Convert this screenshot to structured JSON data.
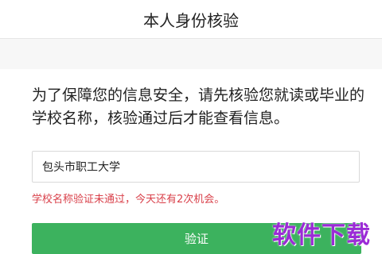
{
  "header": {
    "title": "本人身份核验"
  },
  "intro_text": "为了保障您的信息安全，请先核验您就读或毕业的学校名称，核验通过后才能查看信息。",
  "form": {
    "school_value": "包头市职工大学",
    "error_message": "学校名称验证未通过，今天还有2次机会。",
    "submit_label": "验证"
  },
  "watermark": {
    "text": "软件下载"
  },
  "colors": {
    "accent_green": "#3cb25e",
    "error_red": "#d9404a",
    "watermark_purple": "#9b2bd6"
  }
}
